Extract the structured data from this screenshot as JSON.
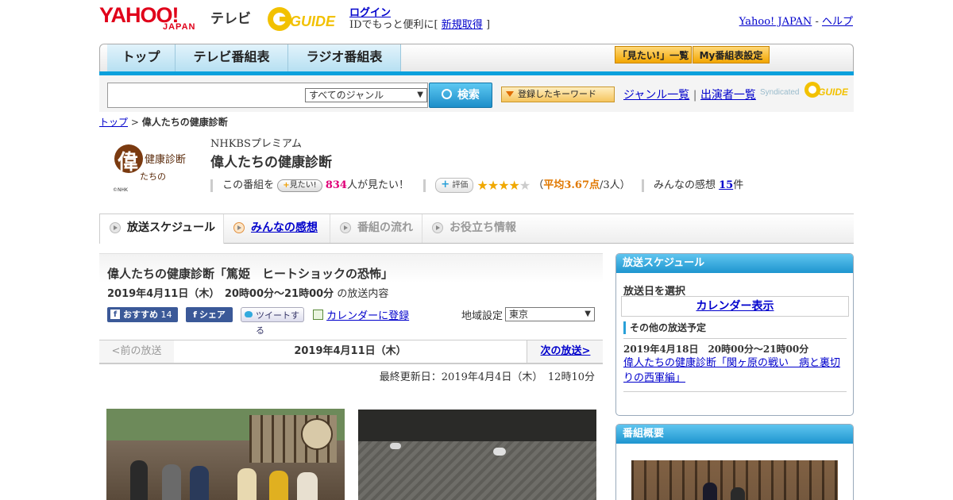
{
  "header": {
    "yahoo": "YAHOO!",
    "japan": "JAPAN",
    "tv": "テレビ",
    "gguide": "GUIDE",
    "login": "ログイン",
    "login_prefix": "IDでもっと便利に[",
    "signup": "新規取得",
    "login_suffix": "]",
    "yahoo_japan_link": "Yahoo! JAPAN",
    "separator": "-",
    "help_link": "ヘルプ"
  },
  "nav": {
    "tabs": [
      "トップ",
      "テレビ番組表",
      "ラジオ番組表"
    ],
    "mitai_list": "「見たい!」一覧",
    "my_schedule": "My番組表設定"
  },
  "search": {
    "genre_selected": "すべてのジャンル",
    "button": "検索",
    "keyword_button": "登録したキーワード",
    "genre_list": "ジャンル一覧",
    "links_sep": "|",
    "performer_list": "出演者一覧",
    "syndicated": "Syndicated",
    "syndicated_logo": "GUIDE"
  },
  "breadcrumb": {
    "top": "トップ",
    "sep": ">",
    "current": "偉人たちの健康診断"
  },
  "program": {
    "logo_text1": "偉",
    "logo_text2": "健康診断",
    "logo_text3": "たちの",
    "logo_nhk": "©NHK",
    "channel": "NHKBSプレミアム",
    "title": "偉人たちの健康診断",
    "stat_prefix": "この番組を",
    "mitai_button": "見たい!",
    "mitai_count": "834",
    "mitai_suffix": "人が見たい！",
    "rating_button": "評価",
    "rating_value": 3.67,
    "rating_open": "（",
    "rating_avg_label": "平均3.67点",
    "rating_count": "/3人）",
    "impressions_label": "みんなの感想",
    "impressions_count": "15",
    "impressions_suffix": "件"
  },
  "program_tabs": [
    "放送スケジュール",
    "みんなの感想",
    "番組の流れ",
    "お役立ち情報"
  ],
  "episode": {
    "title": "偉人たちの健康診断「篤姫　ヒートショックの恐怖」",
    "time": "2019年4月11日（木）　20時00分～21時00分",
    "time_suffix": "の放送内容",
    "fb_recommend": "おすすめ",
    "fb_count": "14",
    "fb_share": "シェア",
    "tweet": "ツイートする",
    "calendar": "カレンダーに登録",
    "region_label": "地域設定",
    "region_value": "東京"
  },
  "date_nav": {
    "prev": "<前の放送",
    "current": "2019年4月11日（木）",
    "next": "次の放送>"
  },
  "updated": "最終更新日：2019年4月4日（木）　12時10分",
  "sidebar": {
    "schedule_title": "放送スケジュール",
    "select_date": "放送日を選択",
    "calendar_display": "カレンダー表示",
    "other_label": "その他の放送予定",
    "other_date": "2019年4月18日　20時00分～21時00分",
    "other_title": "偉人たちの健康診断「関ヶ原の戦い　病と裏切りの西軍編」",
    "overview_title": "番組概要"
  },
  "colors": {
    "accent": "#0aa0dc",
    "brand_red": "#e0001a",
    "pink": "#e00078",
    "orange": "#f2a600"
  }
}
